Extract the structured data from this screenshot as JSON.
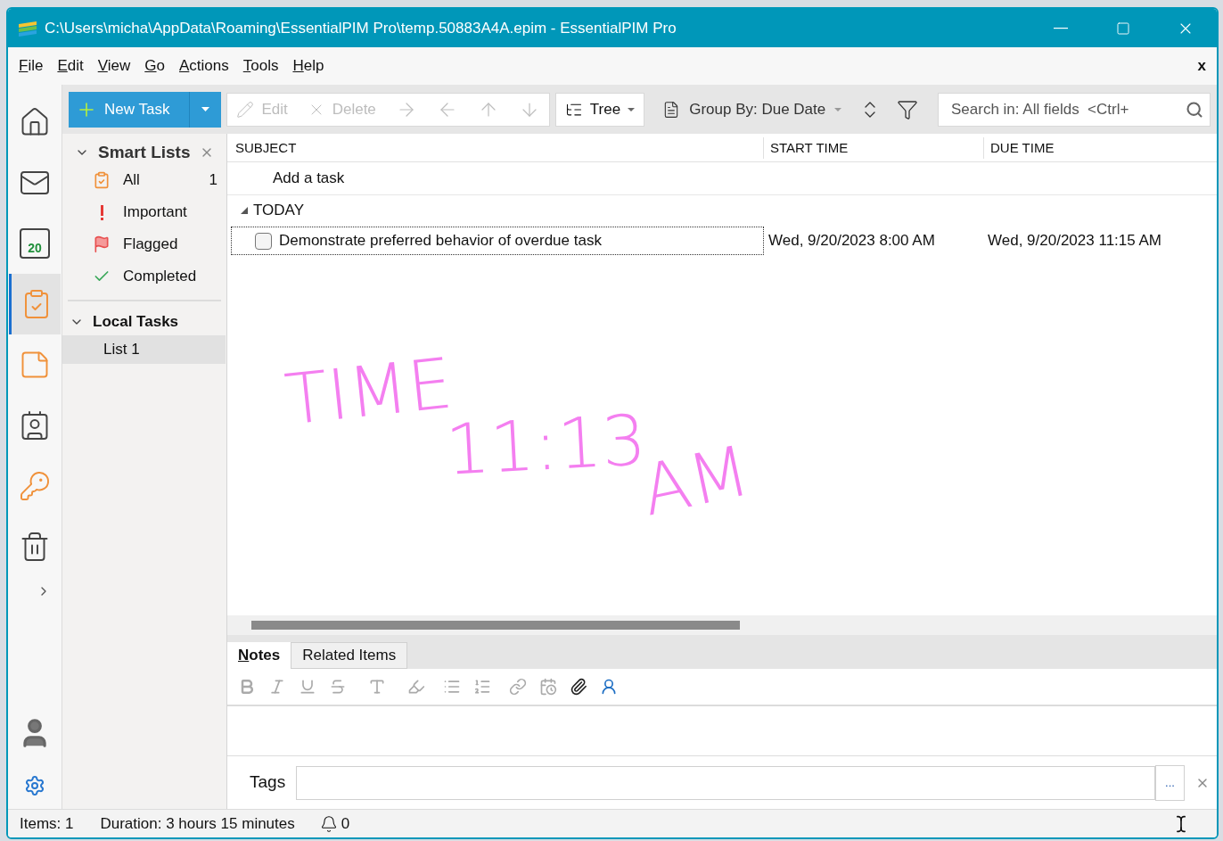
{
  "window": {
    "title": "C:\\Users\\micha\\AppData\\Roaming\\EssentialPIM Pro\\temp.50883A4A.epim - EssentialPIM Pro"
  },
  "menu": {
    "items": [
      "File",
      "Edit",
      "View",
      "Go",
      "Actions",
      "Tools",
      "Help"
    ],
    "close": "x"
  },
  "rail": [
    {
      "kind": "home",
      "selected": false
    },
    {
      "kind": "mail",
      "selected": false
    },
    {
      "kind": "calendar",
      "label": "20",
      "selected": false
    },
    {
      "kind": "tasks",
      "selected": true
    },
    {
      "kind": "note",
      "selected": false
    },
    {
      "kind": "contact",
      "selected": false
    },
    {
      "kind": "key",
      "selected": false
    },
    {
      "kind": "trash",
      "selected": false
    }
  ],
  "toolbar": {
    "new_task": "New Task",
    "edit": {
      "label": "Edit",
      "disabled": true
    },
    "delete": {
      "label": "Delete",
      "disabled": true
    },
    "view": "Tree",
    "group_by": "Group By: Due Date",
    "search": {
      "placeholder": "Search in: All fields  <Ctrl+"
    }
  },
  "smart_lists": {
    "title": "Smart Lists",
    "expanded": true,
    "items": [
      {
        "kind": "all",
        "label": "All",
        "count": "1"
      },
      {
        "kind": "important",
        "label": "Important"
      },
      {
        "kind": "flagged",
        "label": "Flagged"
      },
      {
        "kind": "completed",
        "label": "Completed"
      }
    ]
  },
  "local_tasks": {
    "title": "Local Tasks",
    "expanded": true,
    "items": [
      {
        "label": "List 1",
        "selected": true
      }
    ]
  },
  "table": {
    "columns": [
      "SUBJECT",
      "START TIME",
      "DUE TIME"
    ],
    "add_task": "Add a task",
    "groups": [
      {
        "title": "TODAY",
        "expanded": true,
        "tasks": [
          {
            "subject": "Demonstrate preferred behavior of overdue task",
            "start": "Wed, 9/20/2023 8:00 AM",
            "due": "Wed, 9/20/2023 11:15 AM",
            "completed": false,
            "selected": true
          }
        ]
      }
    ]
  },
  "ink": {
    "color": "#f47ff0",
    "words": [
      "TIME",
      "11:13",
      "AM"
    ]
  },
  "notes": {
    "tabs": [
      {
        "label": "Notes",
        "selected": true
      },
      {
        "label": "Related Items",
        "selected": false
      }
    ],
    "tags_label": "Tags",
    "tags_button": "..."
  },
  "status_bar": {
    "items": "Items: 1",
    "duration": "Duration: 3 hours 15 minutes",
    "reminders": "0"
  }
}
